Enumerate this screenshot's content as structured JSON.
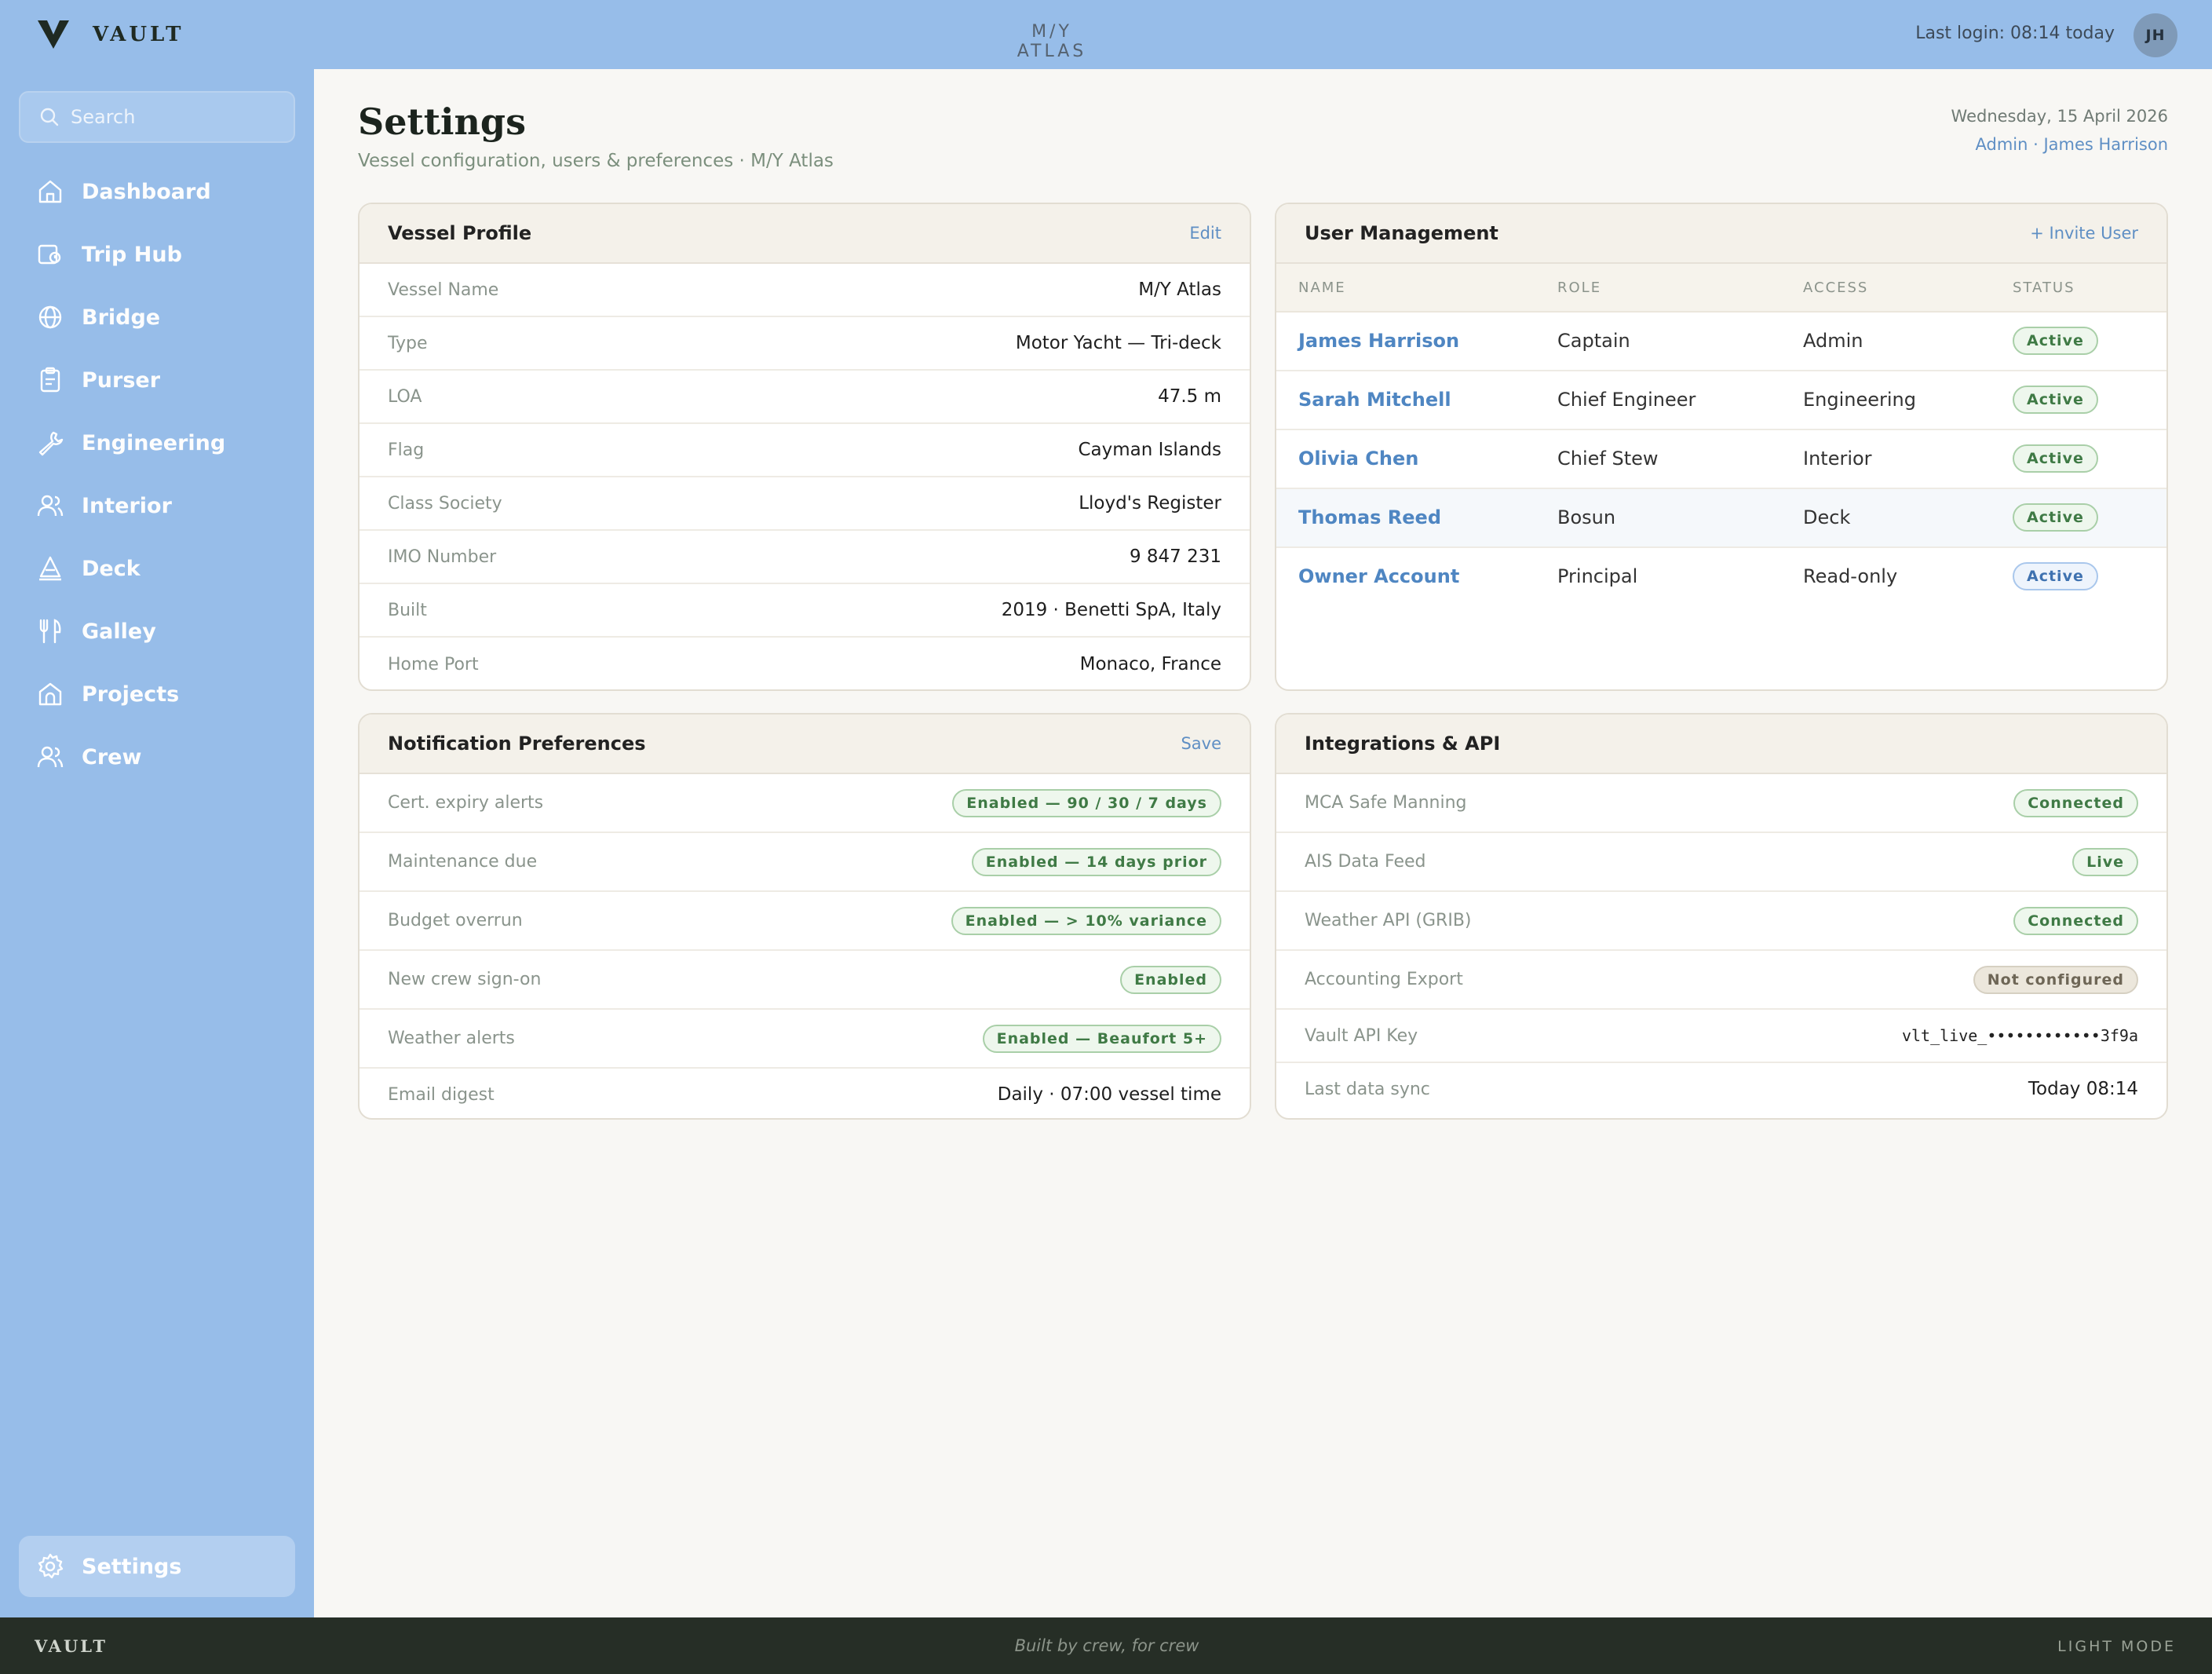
{
  "app": {
    "logo_text": "VAULT",
    "vessel_title": "M/Y ATLAS",
    "last_login": "Last login: 08:14 today",
    "avatar_initials": "JH"
  },
  "sidebar": {
    "search_placeholder": "Search",
    "items": [
      {
        "label": "Dashboard",
        "icon": "home-icon"
      },
      {
        "label": "Trip Hub",
        "icon": "map-pin-icon"
      },
      {
        "label": "Bridge",
        "icon": "globe-icon"
      },
      {
        "label": "Purser",
        "icon": "clipboard-icon"
      },
      {
        "label": "Engineering",
        "icon": "wrench-icon"
      },
      {
        "label": "Interior",
        "icon": "users-icon"
      },
      {
        "label": "Deck",
        "icon": "sail-icon"
      },
      {
        "label": "Galley",
        "icon": "utensils-icon"
      },
      {
        "label": "Projects",
        "icon": "building-icon"
      },
      {
        "label": "Crew",
        "icon": "users-icon"
      }
    ],
    "settings_label": "Settings"
  },
  "header": {
    "title": "Settings",
    "subtitle": "Vessel configuration, users & preferences · M/Y Atlas",
    "date": "Wednesday, 15 April 2026",
    "admin": "Admin · James Harrison"
  },
  "vessel_profile": {
    "title": "Vessel Profile",
    "action": "Edit",
    "rows": [
      {
        "label": "Vessel Name",
        "value": "M/Y Atlas"
      },
      {
        "label": "Type",
        "value": "Motor Yacht — Tri-deck"
      },
      {
        "label": "LOA",
        "value": "47.5 m"
      },
      {
        "label": "Flag",
        "value": "Cayman Islands"
      },
      {
        "label": "Class Society",
        "value": "Lloyd's Register"
      },
      {
        "label": "IMO Number",
        "value": "9 847 231"
      },
      {
        "label": "Built",
        "value": "2019 · Benetti SpA, Italy"
      },
      {
        "label": "Home Port",
        "value": "Monaco, France"
      }
    ]
  },
  "user_management": {
    "title": "User Management",
    "action": "+ Invite User",
    "columns": [
      "NAME",
      "ROLE",
      "ACCESS",
      "STATUS"
    ],
    "users": [
      {
        "name": "James Harrison",
        "role": "Captain",
        "access": "Admin",
        "status": "Active"
      },
      {
        "name": "Sarah Mitchell",
        "role": "Chief Engineer",
        "access": "Engineering",
        "status": "Active"
      },
      {
        "name": "Olivia Chen",
        "role": "Chief Stew",
        "access": "Interior",
        "status": "Active"
      },
      {
        "name": "Thomas Reed",
        "role": "Bosun",
        "access": "Deck",
        "status": "Active"
      },
      {
        "name": "Owner Account",
        "role": "Principal",
        "access": "Read-only",
        "status": "Active"
      }
    ]
  },
  "notifications": {
    "title": "Notification Preferences",
    "action": "Save",
    "rows": [
      {
        "label": "Cert. expiry alerts",
        "value": "Enabled — 90 / 30 / 7 days"
      },
      {
        "label": "Maintenance due",
        "value": "Enabled — 14 days prior"
      },
      {
        "label": "Budget overrun",
        "value": "Enabled — > 10% variance"
      },
      {
        "label": "New crew sign-on",
        "value": "Enabled"
      },
      {
        "label": "Weather alerts",
        "value": "Enabled — Beaufort 5+"
      },
      {
        "label": "Email digest",
        "value": "Daily · 07:00 vessel time"
      }
    ]
  },
  "integrations": {
    "title": "Integrations & API",
    "rows": [
      {
        "label": "MCA Safe Manning",
        "value": "Connected"
      },
      {
        "label": "AIS Data Feed",
        "value": "Live"
      },
      {
        "label": "Weather API (GRIB)",
        "value": "Connected"
      },
      {
        "label": "Accounting Export",
        "value": "Not configured"
      },
      {
        "label": "Vault API Key",
        "value": "vlt_live_••••••••••••3f9a"
      },
      {
        "label": "Last data sync",
        "value": "Today 08:14"
      }
    ]
  },
  "footer": {
    "logo": "VAULT",
    "tagline": "Built by crew, for crew",
    "mode": "LIGHT MODE"
  },
  "colors": {
    "sidebar": "#97bde9",
    "accent": "#5f8fc4",
    "footer": "#262e26",
    "success": "#3f7a45"
  }
}
